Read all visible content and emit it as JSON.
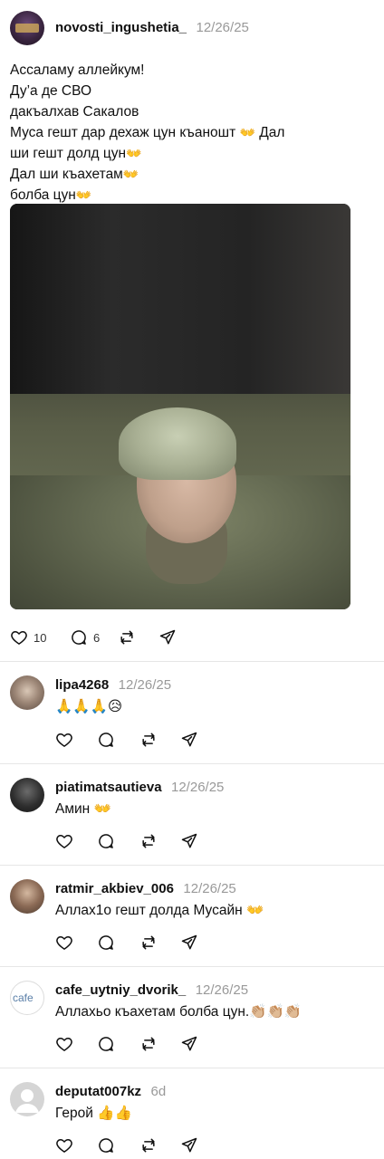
{
  "post": {
    "username": "novosti_ingushetia_",
    "timestamp": "12/26/25",
    "caption_lines": [
      "Ассаламу аллейкум!",
      "Ду’а де СВО",
      "дакъалхав Сакалов",
      "Муса гешт дар дехаж цун къаношт",
      "Дал",
      "ши гешт долд цун",
      "Дал ши къахетам",
      "болба цун"
    ],
    "emoji": "👐",
    "likes": "10",
    "replies": "6"
  },
  "comments": [
    {
      "username": "lipa4268",
      "timestamp": "12/26/25",
      "text": "🙏🙏🙏😥"
    },
    {
      "username": "piatimatsautieva",
      "timestamp": "12/26/25",
      "text": "Амин 👐"
    },
    {
      "username": "ratmir_akbiev_006",
      "timestamp": "12/26/25",
      "text": "Аллах1о гешт долда Мусайн 👐"
    },
    {
      "username": "cafe_uytniy_dvorik_",
      "timestamp": "12/26/25",
      "text": "Аллахьо къахетам болба цун.👏🏼👏🏼👏🏼",
      "avatar_text": "cafe"
    },
    {
      "username": "deputat007kz",
      "timestamp": "6d",
      "text": "Герой 👍👍"
    }
  ]
}
